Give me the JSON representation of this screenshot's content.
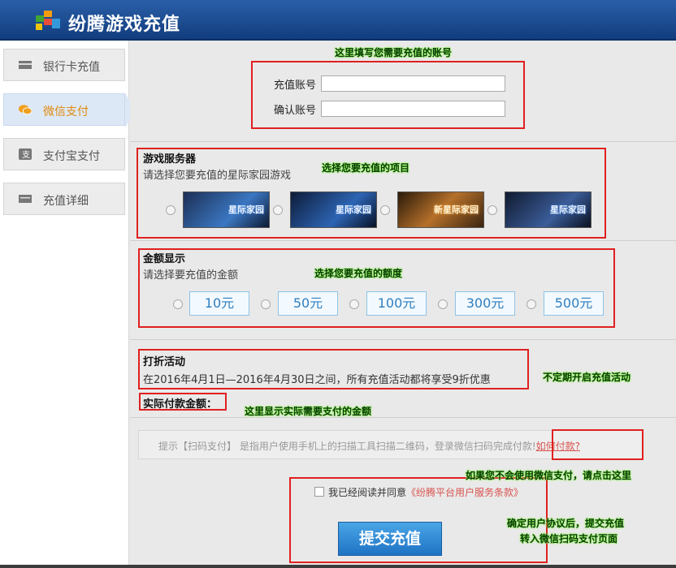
{
  "header": {
    "title": "纷腾游戏充值"
  },
  "sidebar": {
    "items": [
      {
        "label": "银行卡充值",
        "icon": "card-icon"
      },
      {
        "label": "微信支付",
        "icon": "wechat-icon",
        "active": true
      },
      {
        "label": "支付宝支付",
        "icon": "alipay-icon"
      },
      {
        "label": "充值详细",
        "icon": "detail-icon"
      }
    ]
  },
  "account": {
    "label1": "充值账号",
    "label2": "确认账号",
    "value1": "",
    "value2": ""
  },
  "server": {
    "title": "游戏服务器",
    "subtitle": "请选择您要充值的星际家园游戏",
    "games": [
      "星际家园",
      "星际家园",
      "新星际家园",
      "星际家园"
    ]
  },
  "amount": {
    "title": "金额显示",
    "subtitle": "请选择要充值的金额",
    "options": [
      "10元",
      "50元",
      "100元",
      "300元",
      "500元"
    ]
  },
  "promo": {
    "title": "打折活动",
    "text": "在2016年4月1日—2016年4月30日之间，所有充值活动都将享受9折优惠"
  },
  "actual": {
    "label": "实际付款金额："
  },
  "tip": {
    "text": "提示【扫码支付】 是指用户使用手机上的扫描工具扫描二维码，登录微信扫码完成付款!",
    "link": "如何付款?"
  },
  "agreement": {
    "text": "我已经阅读并同意",
    "link": "《纷腾平台用户服务条款》"
  },
  "submit": {
    "label": "提交充值"
  },
  "annotations": {
    "account": "这里填写您需要充值的账号",
    "server": "选择您要充值的项目",
    "amount": "选择您要充值的额度",
    "promo": "不定期开启充值活动",
    "actual": "这里显示实际需要支付的金额",
    "howto": "如果您不会使用微信支付，请点击这里",
    "submit_line1": "确定用户协议后，提交充值",
    "submit_line2": "转入微信扫码支付页面"
  },
  "colors": {
    "header": "#1a4a8f",
    "annotation_box": "#e02020",
    "annotation_text_glow": "#8dff4a",
    "amount_text": "#2f7fbf"
  }
}
